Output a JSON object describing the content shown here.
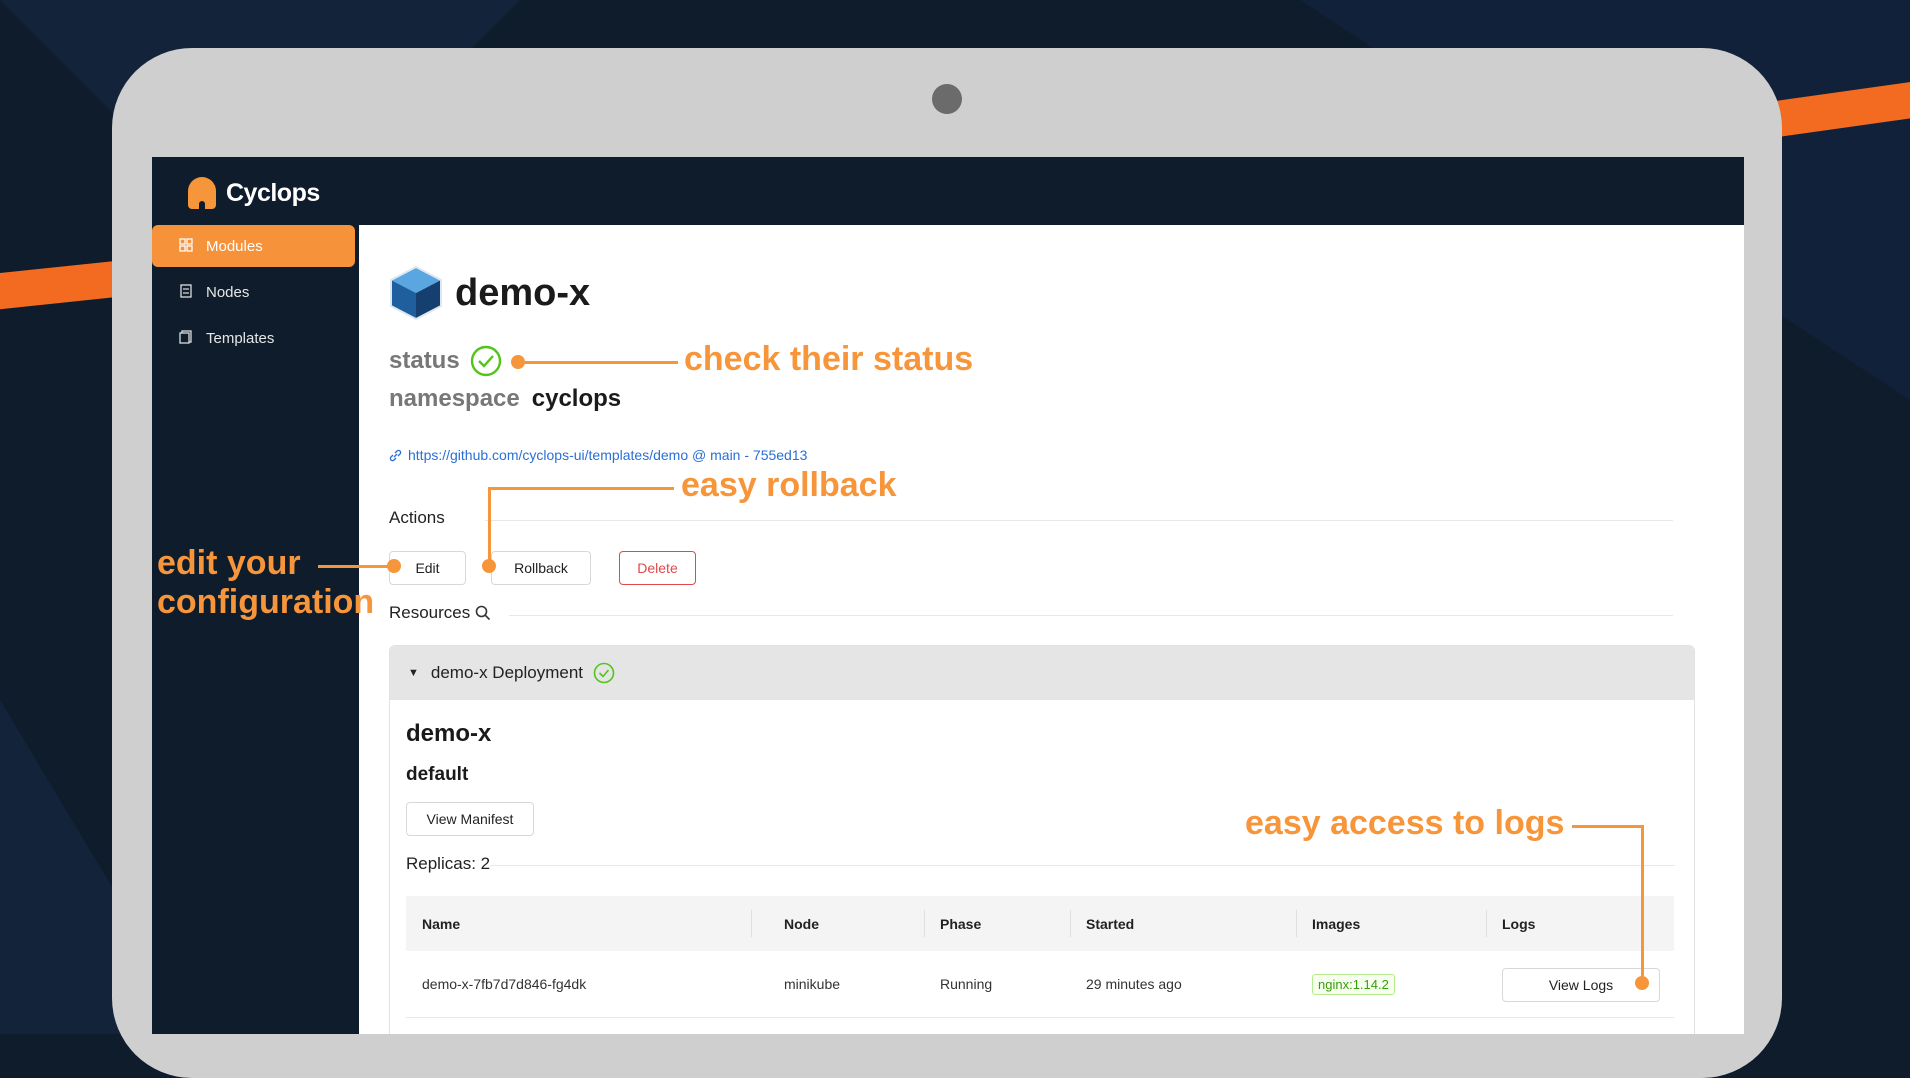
{
  "app": {
    "name": "Cyclops"
  },
  "sidebar": {
    "items": [
      {
        "label": "Modules",
        "icon": "modules-icon",
        "active": true
      },
      {
        "label": "Nodes",
        "icon": "nodes-icon",
        "active": false
      },
      {
        "label": "Templates",
        "icon": "templates-icon",
        "active": false
      }
    ]
  },
  "module": {
    "name": "demo-x",
    "status_label": "status",
    "namespace_label": "namespace",
    "namespace_value": "cyclops",
    "template_link": "https://github.com/cyclops-ui/templates/demo @ main - 755ed13"
  },
  "actions": {
    "title": "Actions",
    "edit": "Edit",
    "rollback": "Rollback",
    "delete": "Delete"
  },
  "resources": {
    "title": "Resources",
    "panel_title": "demo-x Deployment",
    "name": "demo-x",
    "namespace": "default",
    "view_manifest": "View Manifest",
    "replicas": "Replicas: 2",
    "table": {
      "headers": [
        "Name",
        "Node",
        "Phase",
        "Started",
        "Images",
        "Logs"
      ],
      "rows": [
        {
          "name": "demo-x-7fb7d7d846-fg4dk",
          "node": "minikube",
          "phase": "Running",
          "started": "29 minutes ago",
          "image": "nginx:1.14.2",
          "logs": "View Logs"
        }
      ]
    }
  },
  "annotations": {
    "status": "check their status",
    "rollback": "easy rollback",
    "edit_line1": "edit your",
    "edit_line2": "configuration",
    "logs": "easy access to logs"
  },
  "colors": {
    "accent": "#f5923a",
    "background": "#0f1c2c",
    "success": "#52c41a",
    "danger": "#e04a4a",
    "link": "#2a6fd6"
  }
}
